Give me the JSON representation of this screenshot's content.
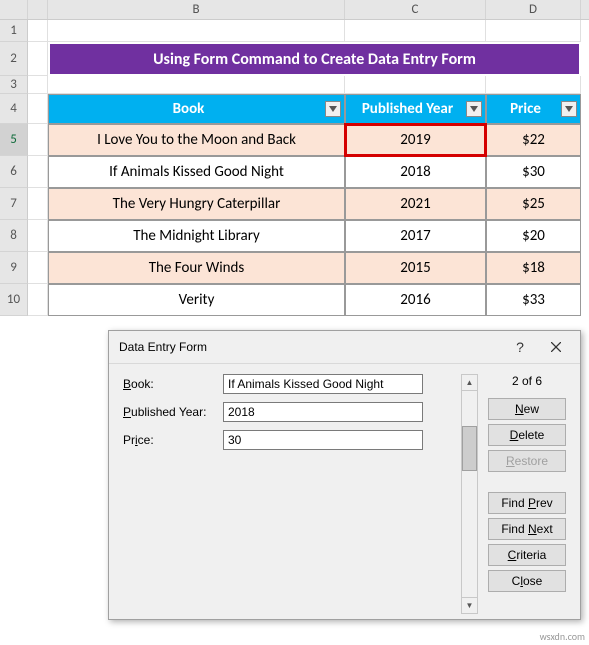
{
  "columns": {
    "B": "B",
    "C": "C",
    "D": "D"
  },
  "rows": [
    "1",
    "2",
    "3",
    "4",
    "5",
    "6",
    "7",
    "8",
    "9",
    "10"
  ],
  "title": "Using Form Command to Create Data Entry Form",
  "headers": {
    "book": "Book",
    "year": "Published Year",
    "price": "Price"
  },
  "data": [
    {
      "book": "I Love You to the Moon and Back",
      "year": "2019",
      "price": "$22"
    },
    {
      "book": "If Animals Kissed Good Night",
      "year": "2018",
      "price": "$30"
    },
    {
      "book": "The Very Hungry Caterpillar",
      "year": "2021",
      "price": "$25"
    },
    {
      "book": "The Midnight Library",
      "year": "2017",
      "price": "$20"
    },
    {
      "book": "The Four Winds",
      "year": "2015",
      "price": "$18"
    },
    {
      "book": "Verity",
      "year": "2016",
      "price": "$33"
    }
  ],
  "dialog": {
    "title": "Data Entry Form",
    "counter": "2 of 6",
    "labels": {
      "book": "Book:",
      "year": "Published Year:",
      "price": "Price:"
    },
    "values": {
      "book": "If Animals Kissed Good Night",
      "year": "2018",
      "price": "30"
    },
    "buttons": {
      "new": "New",
      "delete": "Delete",
      "restore": "Restore",
      "findprev": "Find Prev",
      "findnext": "Find Next",
      "criteria": "Criteria",
      "close": "Close"
    }
  },
  "watermark": "wsxdn.com"
}
